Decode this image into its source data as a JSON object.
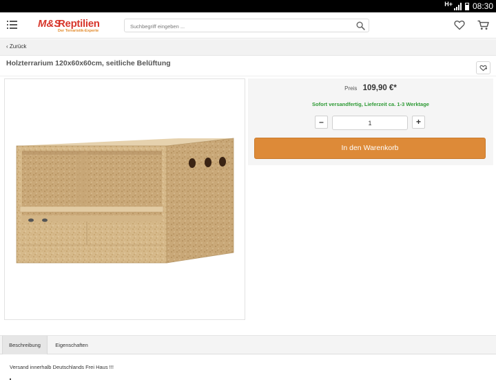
{
  "status_bar": {
    "network": "H+",
    "time": "08:30"
  },
  "header": {
    "logo_ms": "M&S",
    "logo_brand": "Reptilien",
    "logo_tagline": "Der Terraristik-Experte",
    "search": {
      "placeholder": "Suchbegriff eingeben ...",
      "value": ""
    }
  },
  "breadcrumb": {
    "back_label": "‹ Zurück"
  },
  "product": {
    "title": "Holzterrarium 120x60x60cm, seitliche Belüftung",
    "price_label": "Preis",
    "price": "109,90 €*",
    "delivery": "Sofort versandfertig, Lieferzeit ca. 1-3 Werktage",
    "quantity": "1",
    "minus_label": "–",
    "plus_label": "+",
    "add_to_cart": "In den Warenkorb"
  },
  "tabs": [
    {
      "label": "Beschreibung",
      "active": true
    },
    {
      "label": "Eigenschaften",
      "active": false
    }
  ],
  "description": "Versand innerhalb Deutschlands Frei Haus !!!",
  "colors": {
    "accent": "#dd8a38",
    "brand_red": "#d7362b",
    "delivery_green": "#2e9a35"
  },
  "icons": [
    "menu-icon",
    "search-icon",
    "heart-icon",
    "cart-icon",
    "share-icon"
  ]
}
